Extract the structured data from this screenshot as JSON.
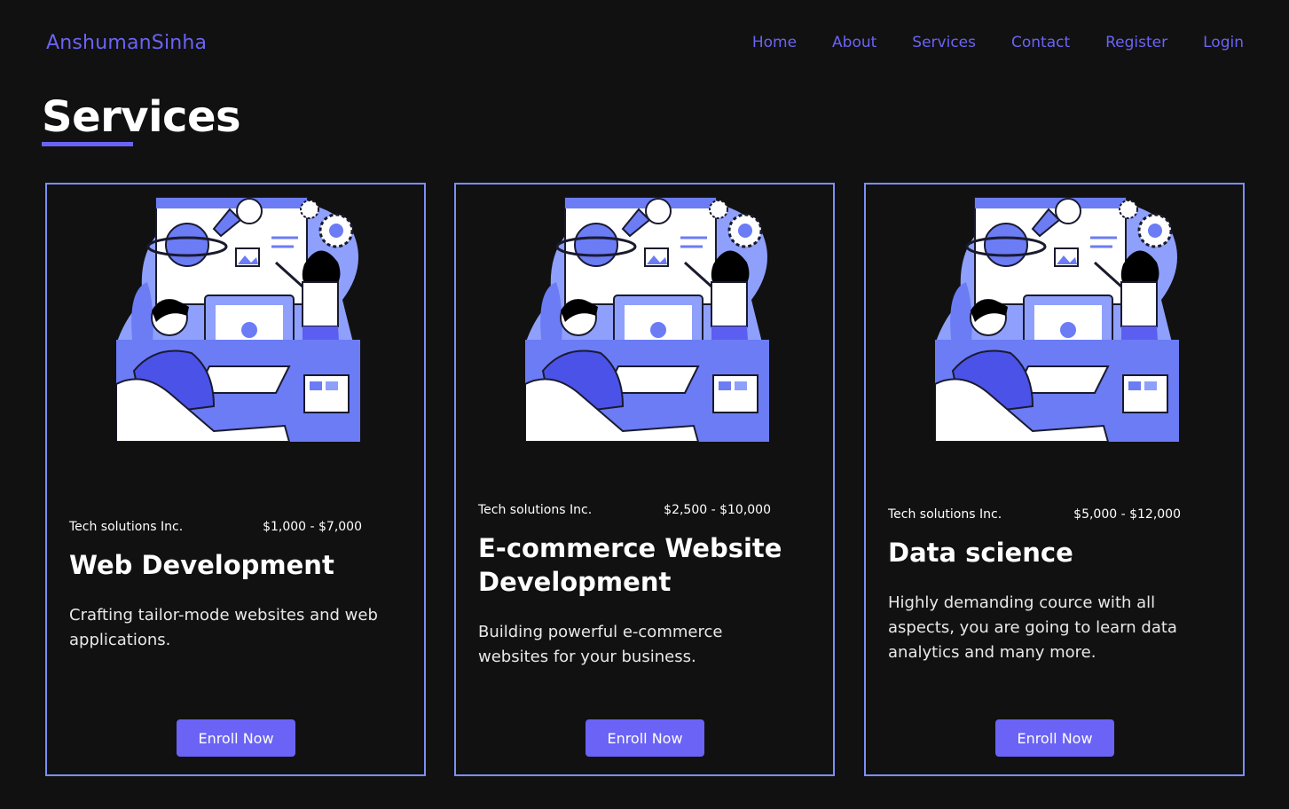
{
  "brand": "AnshumanSinha",
  "nav": [
    "Home",
    "About",
    "Services",
    "Contact",
    "Register",
    "Login"
  ],
  "page_title": "Services",
  "colors": {
    "accent": "#6b63f5",
    "card_border": "#7c8ff5",
    "background": "#111111"
  },
  "cards": [
    {
      "company": "Tech solutions Inc.",
      "price": "$1,000 - $7,000",
      "title": "Web Development",
      "description": "Crafting tailor-mode websites and web applications.",
      "button": "Enroll Now",
      "image": "web-designer-illustration"
    },
    {
      "company": "Tech solutions Inc.",
      "price": "$2,500 - $10,000",
      "title": "E-commerce Website Development",
      "description": "Building powerful e-commerce websites for your business.",
      "button": "Enroll Now",
      "image": "web-designer-illustration"
    },
    {
      "company": "Tech solutions Inc.",
      "price": "$5,000 - $12,000",
      "title": "Data science",
      "description": "Highly demanding cource with all aspects, you are going to learn data analytics and many more.",
      "button": "Enroll Now",
      "image": "web-designer-illustration"
    }
  ]
}
